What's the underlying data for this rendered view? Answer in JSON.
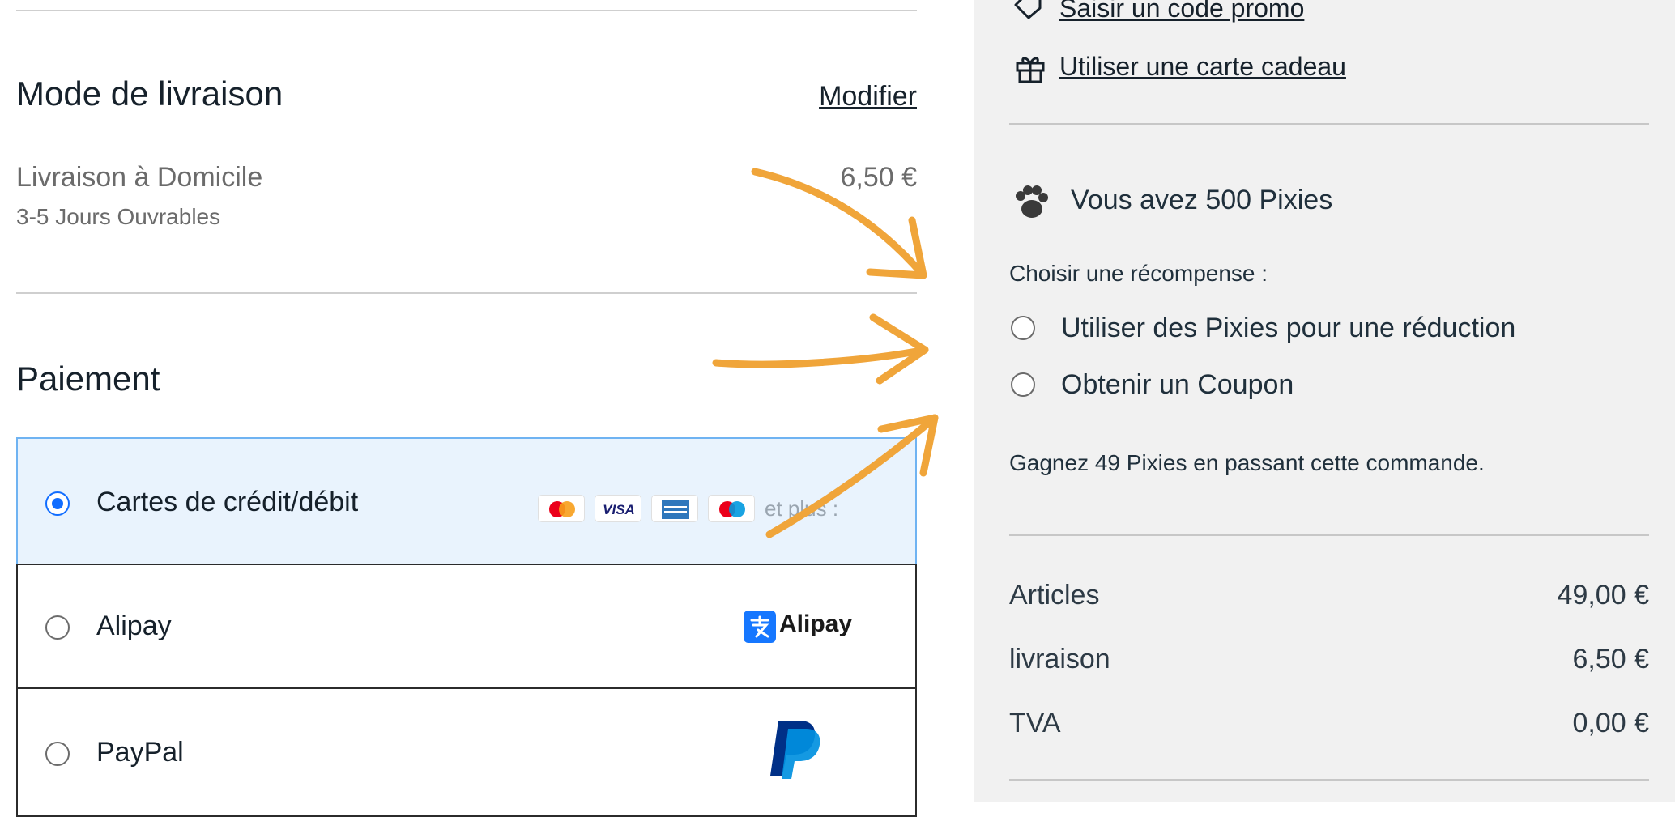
{
  "shipping": {
    "title": "Mode de livraison",
    "modify_label": "Modifier",
    "method_name": "Livraison à Domicile",
    "method_delay": "3-5 Jours Ouvrables",
    "method_price": "6,50 €"
  },
  "payment": {
    "title": "Paiement",
    "options": [
      {
        "label": "Cartes de crédit/débit",
        "selected": true,
        "more_label": "et plus :",
        "card_icons": [
          "mastercard-icon",
          "visa-icon",
          "amex-icon",
          "maestro-icon"
        ]
      },
      {
        "label": "Alipay",
        "selected": false,
        "logo_text": "Alipay"
      },
      {
        "label": "PayPal",
        "selected": false,
        "logo_icon": "paypal-icon"
      }
    ],
    "visa_text": "VISA"
  },
  "sidebar": {
    "promo_link": "Saisir un code promo",
    "gift_link": "Utiliser une carte cadeau",
    "pixies_balance": "Vous avez 500 Pixies",
    "reward_prompt": "Choisir une récompense :",
    "rewards": [
      {
        "label": "Utiliser des Pixies pour une réduction",
        "selected": false
      },
      {
        "label": "Obtenir un Coupon",
        "selected": false
      }
    ],
    "earn_note": "Gagnez 49 Pixies en passant cette commande.",
    "summary": [
      {
        "label": "Articles",
        "value": "49,00 €"
      },
      {
        "label": "livraison",
        "value": "6,50 €"
      },
      {
        "label": "TVA",
        "value": "0,00 €"
      }
    ]
  },
  "colors": {
    "accent": "#116dff",
    "selected_bg": "#e9f3fd",
    "arrow": "#f0a53a",
    "panel_bg": "#f1f1f1"
  }
}
